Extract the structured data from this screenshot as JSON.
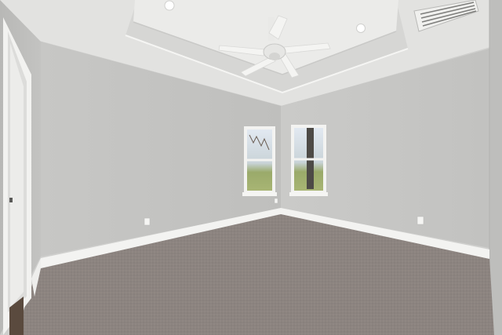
{
  "scene": {
    "subject": "empty-room",
    "palette": {
      "ceiling": "#e4e4e2",
      "tray_face": "#d8d8d6",
      "back_wall": "#c4c4c2",
      "left_wall": "#bdbdbb",
      "right_wall": "#c9c9c7",
      "carpet": "#8c8480",
      "baseboard": "#f4f4f2",
      "trim": "#f2f2f0",
      "fan": "#f1f1ef",
      "window_outdoor": "#9fb06c",
      "window_sky": "#dfe7f0"
    },
    "icons": [
      "ceiling-fan-icon",
      "recessed-light-icon",
      "air-vent-icon",
      "outlet-icon",
      "door-icon",
      "window-icon"
    ]
  }
}
